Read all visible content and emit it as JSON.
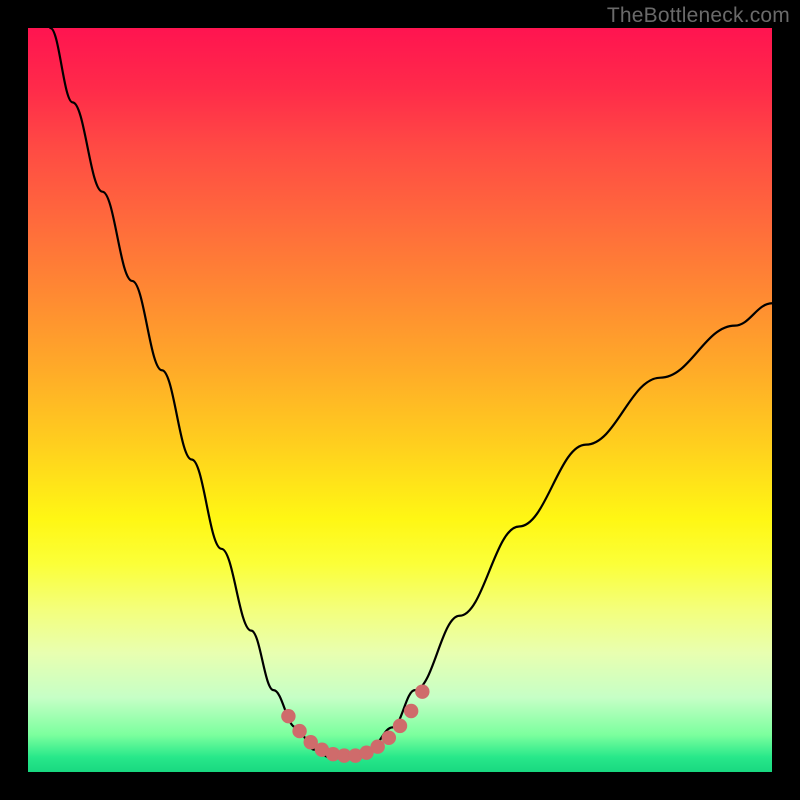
{
  "watermark": "TheBottleneck.com",
  "chart_data": {
    "type": "line",
    "title": "",
    "xlabel": "",
    "ylabel": "",
    "xlim": [
      0,
      100
    ],
    "ylim": [
      0,
      100
    ],
    "series": [
      {
        "name": "bottleneck-curve",
        "x": [
          3,
          6,
          10,
          14,
          18,
          22,
          26,
          30,
          33,
          36,
          38.5,
          40.5,
          42,
          44,
          46,
          49,
          52,
          58,
          66,
          75,
          85,
          95,
          100
        ],
        "y": [
          100,
          90,
          78,
          66,
          54,
          42,
          30,
          19,
          11,
          6,
          3,
          2,
          2,
          2.2,
          3.2,
          6,
          11,
          21,
          33,
          44,
          53,
          60,
          63
        ]
      }
    ],
    "highlight": {
      "name": "optimal-range",
      "color": "#cf6b6b",
      "x": [
        35,
        36.5,
        38,
        39.5,
        41,
        42.5,
        44,
        45.5,
        47,
        48.5,
        50,
        51.5,
        53
      ],
      "y": [
        7.5,
        5.5,
        4,
        3,
        2.4,
        2.2,
        2.2,
        2.6,
        3.4,
        4.6,
        6.2,
        8.2,
        10.8
      ]
    },
    "gradient_stops": [
      {
        "pct": 0,
        "color": "#ff1450"
      },
      {
        "pct": 36,
        "color": "#ff8a32"
      },
      {
        "pct": 66,
        "color": "#fff714"
      },
      {
        "pct": 100,
        "color": "#18d880"
      }
    ]
  }
}
